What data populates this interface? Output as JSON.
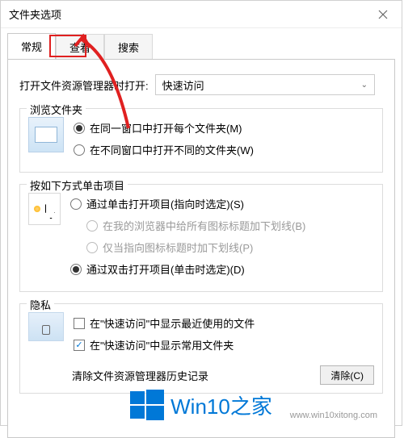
{
  "title": "文件夹选项",
  "tabs": [
    "常规",
    "查看",
    "搜索"
  ],
  "active_tab": 0,
  "open_explorer_label": "打开文件资源管理器时打开:",
  "combo_value": "快速访问",
  "browse": {
    "legend": "浏览文件夹",
    "opt_same": "在同一窗口中打开每个文件夹(M)",
    "opt_new": "在不同窗口中打开不同的文件夹(W)",
    "selected": 0
  },
  "click": {
    "legend": "按如下方式单击项目",
    "opt_single": "通过单击打开项目(指向时选定)(S)",
    "opt_single_a": "在我的浏览器中给所有图标标题加下划线(B)",
    "opt_single_b": "仅当指向图标标题时加下划线(P)",
    "opt_double": "通过双击打开项目(单击时选定)(D)",
    "selected": 1
  },
  "privacy": {
    "legend": "隐私",
    "chk_recent": "在\"快速访问\"中显示最近使用的文件",
    "chk_frequent": "在\"快速访问\"中显示常用文件夹",
    "chk_recent_checked": false,
    "chk_frequent_checked": true,
    "clear_label": "清除文件资源管理器历史记录",
    "clear_btn": "清除(C)"
  },
  "watermark": {
    "logo": "⊞",
    "text": "Win10之家",
    "url": "www.win10xitong.com"
  },
  "annot_color": "#e02020"
}
